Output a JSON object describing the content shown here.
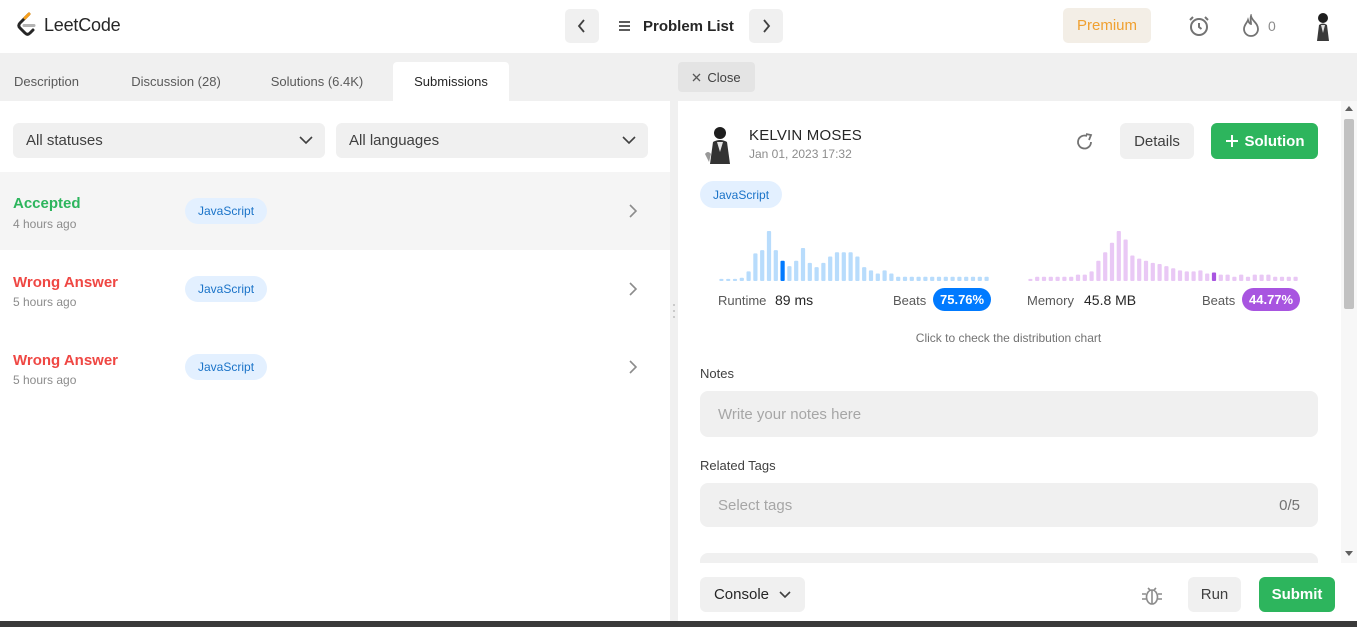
{
  "brand": {
    "name": "LeetCode"
  },
  "topnav": {
    "problem_list_label": "Problem List",
    "premium_label": "Premium",
    "streak_count": "0"
  },
  "tabs": [
    {
      "label": "Description"
    },
    {
      "label": "Discussion (28)"
    },
    {
      "label": "Solutions (6.4K)"
    },
    {
      "label": "Submissions"
    }
  ],
  "filters": {
    "status": "All statuses",
    "language": "All languages"
  },
  "submissions": [
    {
      "status": "Accepted",
      "time": "4 hours ago",
      "language": "JavaScript"
    },
    {
      "status": "Wrong Answer",
      "time": "5 hours ago",
      "language": "JavaScript"
    },
    {
      "status": "Wrong Answer",
      "time": "5 hours ago",
      "language": "JavaScript"
    }
  ],
  "detail": {
    "close_label": "Close",
    "user_name": "KELVIN MOSES",
    "date": "Jan 01, 2023 17:32",
    "details_label": "Details",
    "solution_label": "Solution",
    "language": "JavaScript",
    "runtime": {
      "label": "Runtime",
      "value": "89 ms",
      "beats_label": "Beats",
      "beats": "75.76%"
    },
    "memory": {
      "label": "Memory",
      "value": "45.8 MB",
      "beats_label": "Beats",
      "beats": "44.77%"
    },
    "distribution_link": "Click to check the distribution chart",
    "notes_label": "Notes",
    "notes_placeholder": "Write your notes here",
    "tags_label": "Related Tags",
    "tags_placeholder": "Select tags",
    "tags_count": "0/5"
  },
  "footer": {
    "console_label": "Console",
    "run_label": "Run",
    "submit_label": "Submit"
  },
  "colors": {
    "accent_green": "#2db55d",
    "error_red": "#ef4743",
    "runtime_blue": "#007aff",
    "memory_purple": "#a855e0",
    "premium_orange": "#f0a030"
  },
  "chart_data": [
    {
      "type": "bar",
      "title": "Runtime",
      "values": [
        2,
        2,
        2,
        3,
        9,
        26,
        29,
        47,
        29,
        19,
        14,
        19,
        31,
        17,
        13,
        17,
        23,
        27,
        27,
        27,
        23,
        13,
        10,
        7,
        10,
        7,
        4,
        4,
        4,
        4,
        4,
        4,
        4,
        4,
        4,
        4,
        4,
        4,
        4,
        4
      ],
      "highlight_index": 9
    },
    {
      "type": "bar",
      "title": "Memory",
      "values": [
        2,
        4,
        4,
        4,
        4,
        4,
        4,
        6,
        6,
        9,
        19,
        27,
        36,
        47,
        39,
        24,
        21,
        19,
        17,
        16,
        14,
        12,
        10,
        9,
        9,
        10,
        7,
        8,
        6,
        6,
        4,
        6,
        4,
        6,
        6,
        6,
        4,
        4,
        4,
        4
      ],
      "highlight_index": 27
    }
  ]
}
